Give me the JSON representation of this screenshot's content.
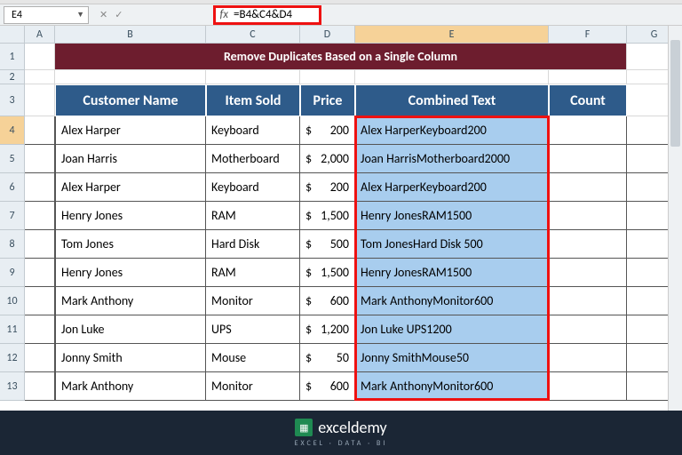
{
  "name_box": "E4",
  "formula": "=B4&C4&D4",
  "columns": [
    "A",
    "B",
    "C",
    "D",
    "E",
    "F",
    "G"
  ],
  "title": "Remove Duplicates Based on a Single Column",
  "headers": {
    "customer": "Customer Name",
    "item": "Item Sold",
    "price": "Price",
    "combined": "Combined Text",
    "count": "Count"
  },
  "currency": "$",
  "rows": [
    {
      "n": 4,
      "name": "Alex Harper",
      "item": "Keyboard",
      "price": "200",
      "combined": "Alex HarperKeyboard200"
    },
    {
      "n": 5,
      "name": "Joan Harris",
      "item": "Motherboard",
      "price": "2,000",
      "combined": "Joan HarrisMotherboard2000"
    },
    {
      "n": 6,
      "name": "Alex Harper",
      "item": "Keyboard",
      "price": "200",
      "combined": "Alex HarperKeyboard200"
    },
    {
      "n": 7,
      "name": "Henry Jones",
      "item": "RAM",
      "price": "1,500",
      "combined": "Henry JonesRAM1500"
    },
    {
      "n": 8,
      "name": "Tom Jones",
      "item": "Hard Disk",
      "price": "500",
      "combined": "Tom JonesHard Disk 500"
    },
    {
      "n": 9,
      "name": "Henry Jones",
      "item": "RAM",
      "price": "1,500",
      "combined": "Henry JonesRAM1500"
    },
    {
      "n": 10,
      "name": "Mark Anthony",
      "item": "Monitor",
      "price": "600",
      "combined": "Mark AnthonyMonitor600"
    },
    {
      "n": 11,
      "name": "Jon Luke",
      "item": "UPS",
      "price": "1,200",
      "combined": "Jon Luke UPS1200"
    },
    {
      "n": 12,
      "name": "Jonny Smith",
      "item": "Mouse",
      "price": "50",
      "combined": "Jonny SmithMouse50"
    },
    {
      "n": 13,
      "name": "Mark Anthony",
      "item": "Monitor",
      "price": "600",
      "combined": "Mark AnthonyMonitor600"
    }
  ],
  "logo": {
    "name": "exceldemy",
    "sub": "EXCEL · DATA · BI"
  }
}
